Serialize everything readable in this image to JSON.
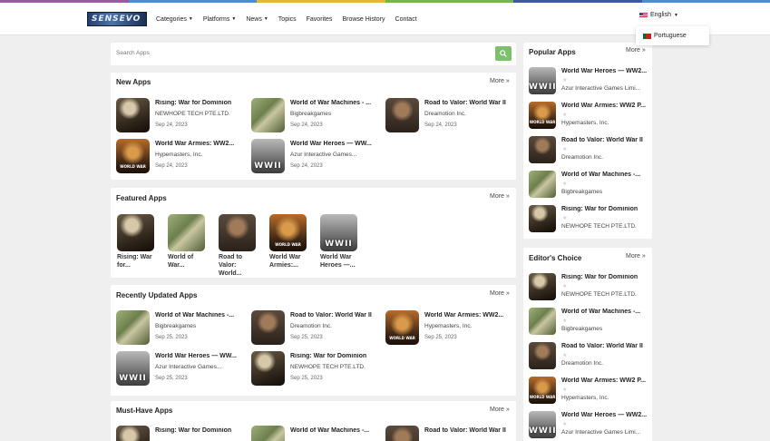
{
  "colors": {
    "bar": [
      "#9b5aa8",
      "#4a8fd0",
      "#e7b53a",
      "#73b64f",
      "#3d5aa0",
      "#4a8fd0"
    ],
    "accent": "#7cc06a"
  },
  "header": {
    "logo_text": "SENSEVO",
    "nav": [
      {
        "label": "Categories",
        "dropdown": true
      },
      {
        "label": "Platforms",
        "dropdown": true
      },
      {
        "label": "News",
        "dropdown": true
      },
      {
        "label": "Topics"
      },
      {
        "label": "Favorites"
      },
      {
        "label": "Browse History"
      },
      {
        "label": "Contact"
      }
    ],
    "language": "English",
    "language_option": "Portuguese"
  },
  "search": {
    "placeholder": "Search Apps",
    "icon": "search-icon"
  },
  "new_apps": {
    "title": "New Apps",
    "more": "More »",
    "items": [
      {
        "name": "Rising: War for Dominion",
        "dev": "NEWHOPE TECH PTE.LTD.",
        "date": "Sep 24, 2023",
        "art": "rising"
      },
      {
        "name": "World of War Machines - ...",
        "dev": "Bigbreakgames",
        "date": "Sep 24, 2023",
        "art": "machines"
      },
      {
        "name": "Road to Valor: World War II",
        "dev": "Dreamotion Inc.",
        "date": "Sep 24, 2023",
        "art": "valor"
      },
      {
        "name": "World War Armies: WW2...",
        "dev": "Hypemasters, Inc.",
        "date": "Sep 24, 2023",
        "art": "armies"
      },
      {
        "name": "World War Heroes — WW...",
        "dev": "Azur Interactive Games...",
        "date": "Sep 24, 2023",
        "art": "heroes"
      }
    ]
  },
  "featured": {
    "title": "Featured Apps",
    "more": "More »",
    "items": [
      {
        "name": "Rising: War for...",
        "art": "rising"
      },
      {
        "name": "World of War...",
        "art": "machines"
      },
      {
        "name": "Road to Valor: World...",
        "art": "valor"
      },
      {
        "name": "World War Armies:...",
        "art": "armies"
      },
      {
        "name": "World War Heroes —...",
        "art": "heroes"
      }
    ]
  },
  "recent": {
    "title": "Recently Updated Apps",
    "more": "More »",
    "items": [
      {
        "name": "World of War Machines -...",
        "dev": "Bigbreakgames",
        "date": "Sep 25, 2023",
        "art": "machines"
      },
      {
        "name": "Road to Valor: World War II",
        "dev": "Dreamotion Inc.",
        "date": "Sep 25, 2023",
        "art": "valor"
      },
      {
        "name": "World War Armies: WW2...",
        "dev": "Hypemasters, Inc.",
        "date": "Sep 25, 2023",
        "art": "armies"
      },
      {
        "name": "World War Heroes — WW...",
        "dev": "Azur Interactive Games...",
        "date": "Sep 25, 2023",
        "art": "heroes"
      },
      {
        "name": "Rising: War for Dominion",
        "dev": "NEWHOPE TECH PTE.LTD.",
        "date": "Sep 25, 2023",
        "art": "rising"
      }
    ]
  },
  "must_have": {
    "title": "Must-Have Apps",
    "more": "More »",
    "items": [
      {
        "name": "Rising: War for Dominion",
        "art": "rising"
      },
      {
        "name": "World of War Machines -...",
        "art": "machines"
      },
      {
        "name": "Road to Valor: World War II",
        "art": "valor"
      }
    ]
  },
  "popular": {
    "title": "Popular Apps",
    "more": "More »",
    "items": [
      {
        "name": "World War Heroes — WW2...",
        "dev": "Azur Interactive Games Limi...",
        "art": "heroes"
      },
      {
        "name": "World War Armies: WW2 P...",
        "dev": "Hypemasters, Inc.",
        "art": "armies"
      },
      {
        "name": "Road to Valor: World War II",
        "dev": "Dreamotion Inc.",
        "art": "valor"
      },
      {
        "name": "World of War Machines -...",
        "dev": "Bigbreakgames",
        "art": "machines"
      },
      {
        "name": "Rising: War for Dominion",
        "dev": "NEWHOPE TECH PTE.LTD.",
        "art": "rising"
      }
    ]
  },
  "editors": {
    "title": "Editor's Choice",
    "more": "More »",
    "items": [
      {
        "name": "Rising: War for Dominion",
        "dev": "NEWHOPE TECH PTE.LTD.",
        "art": "rising"
      },
      {
        "name": "World of War Machines -...",
        "dev": "Bigbreakgames",
        "art": "machines"
      },
      {
        "name": "Road to Valor: World War II",
        "dev": "Dreamotion Inc.",
        "art": "valor"
      },
      {
        "name": "World War Armies: WW2 P...",
        "dev": "Hypemasters, Inc.",
        "art": "armies"
      },
      {
        "name": "World War Heroes — WW2...",
        "dev": "Azur Interactive Games Limi...",
        "art": "heroes"
      }
    ]
  },
  "art_labels": {
    "heroes": "WWII",
    "armies": "WORLD WAR"
  }
}
